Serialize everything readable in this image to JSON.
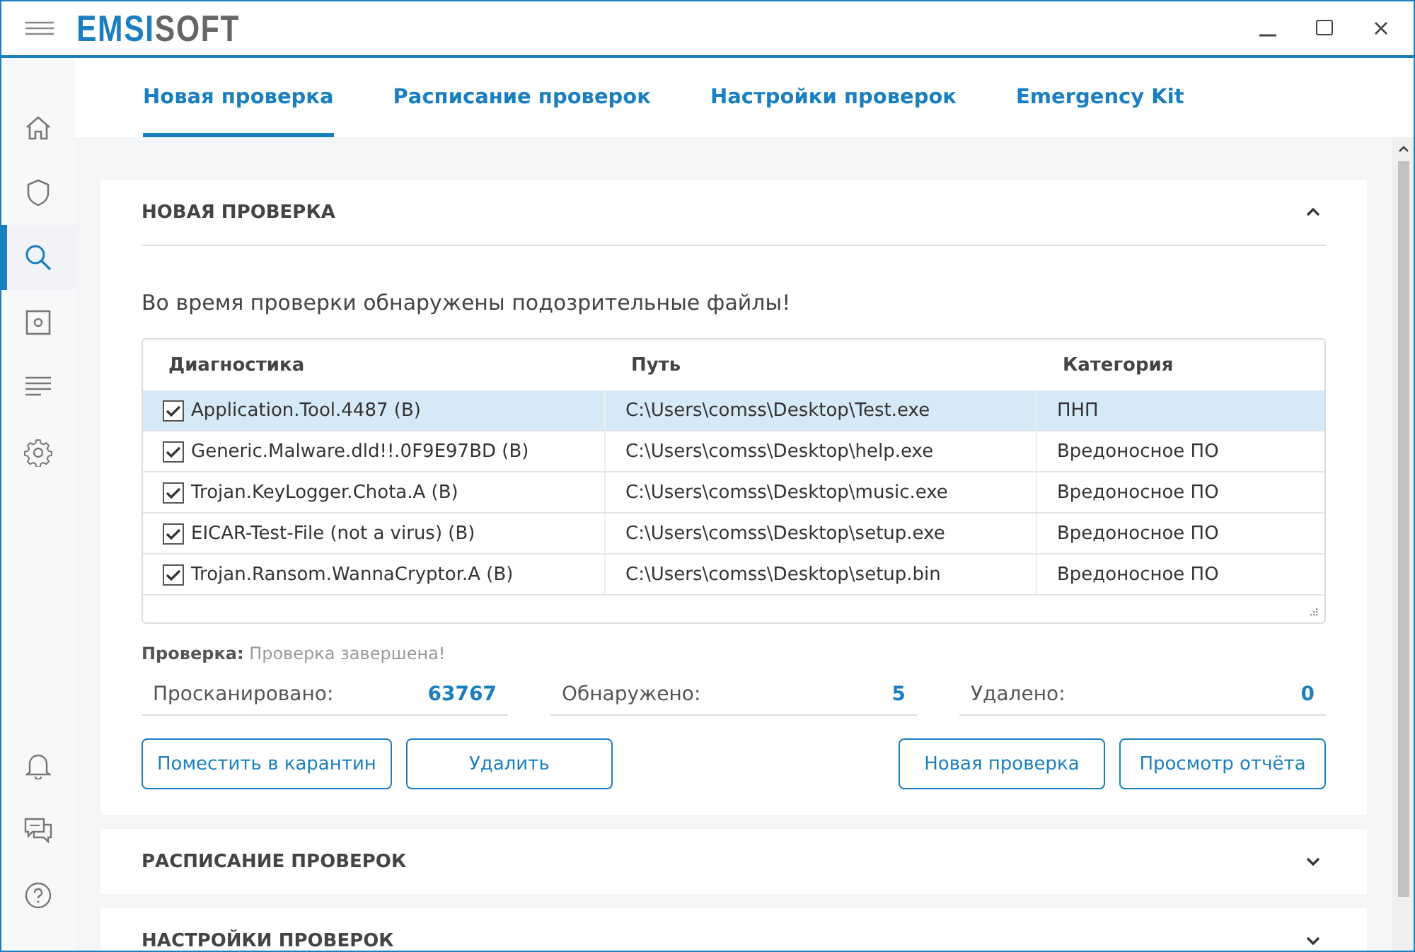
{
  "app": {
    "logo_primary": "EMSI",
    "logo_secondary": "SOFT"
  },
  "sidebar": {
    "items": [
      {
        "kind": "home",
        "selected": false
      },
      {
        "kind": "shield",
        "selected": false
      },
      {
        "kind": "search",
        "selected": true
      },
      {
        "kind": "quarantine",
        "selected": false
      },
      {
        "kind": "logs",
        "selected": false
      },
      {
        "kind": "settings",
        "selected": false
      }
    ],
    "bottom_items": [
      {
        "kind": "bell"
      },
      {
        "kind": "chat"
      },
      {
        "kind": "help"
      }
    ]
  },
  "tabs": [
    {
      "label": "Новая проверка",
      "selected": true
    },
    {
      "label": "Расписание проверок",
      "selected": false
    },
    {
      "label": "Настройки проверок",
      "selected": false
    },
    {
      "label": "Emergency Kit",
      "selected": false
    }
  ],
  "sections": [
    {
      "title": "НОВАЯ ПРОВЕРКА",
      "expanded": true,
      "message": "Во время проверки обнаружены подозрительные файлы!",
      "table": {
        "columns": [
          "Диагностика",
          "Путь",
          "Категория"
        ],
        "rows": [
          {
            "checked": true,
            "selected": true,
            "cells": [
              "Application.Tool.4487 (B)",
              "C:\\Users\\comss\\Desktop\\Test.exe",
              "ПНП"
            ]
          },
          {
            "checked": true,
            "selected": false,
            "cells": [
              "Generic.Malware.dld!!.0F9E97BD (B)",
              "C:\\Users\\comss\\Desktop\\help.exe",
              "Вредоносное ПО"
            ]
          },
          {
            "checked": true,
            "selected": false,
            "cells": [
              "Trojan.KeyLogger.Chota.A (B)",
              "C:\\Users\\comss\\Desktop\\music.exe",
              "Вредоносное ПО"
            ]
          },
          {
            "checked": true,
            "selected": false,
            "cells": [
              "EICAR-Test-File (not a virus) (B)",
              "C:\\Users\\comss\\Desktop\\setup.exe",
              "Вредоносное ПО"
            ]
          },
          {
            "checked": true,
            "selected": false,
            "cells": [
              "Trojan.Ransom.WannaCryptor.A (B)",
              "C:\\Users\\comss\\Desktop\\setup.bin",
              "Вредоносное ПО"
            ]
          }
        ]
      },
      "status_label": "Проверка:",
      "status_value": "Проверка завершена!",
      "stats": [
        {
          "label": "Просканировано:",
          "value": "63767"
        },
        {
          "label": "Обнаружено:",
          "value": "5"
        },
        {
          "label": "Удалено:",
          "value": "0"
        }
      ],
      "left_buttons": [
        "Поместить в карантин",
        "Удалить"
      ],
      "right_buttons": [
        "Новая проверка",
        "Просмотр отчёта"
      ]
    },
    {
      "title": "РАСПИСАНИЕ ПРОВЕРОК",
      "expanded": false
    },
    {
      "title": "НАСТРОЙКИ ПРОВЕРОК",
      "expanded": false
    }
  ]
}
